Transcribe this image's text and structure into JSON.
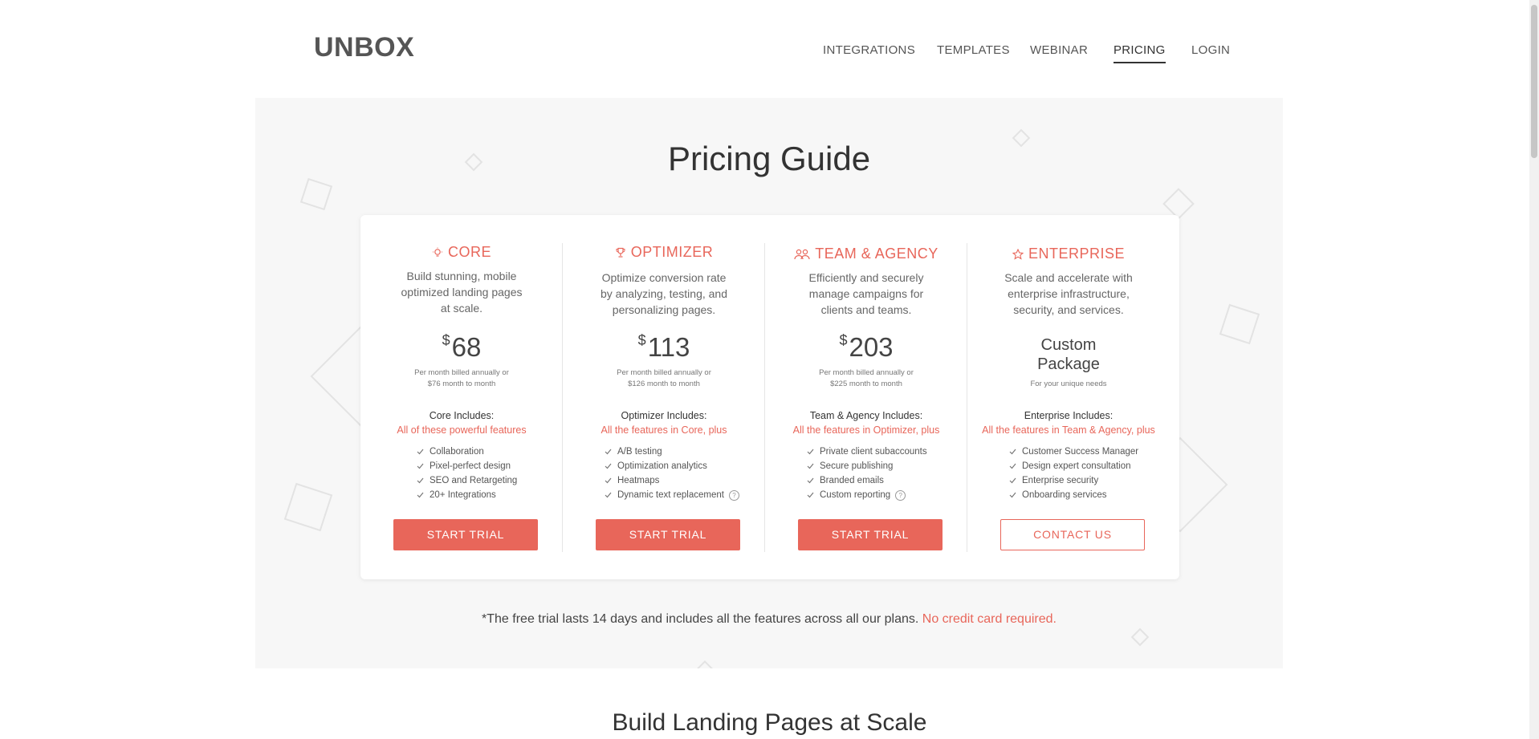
{
  "header": {
    "logo": "UNBOX",
    "nav": [
      "INTEGRATIONS",
      "TEMPLATES",
      "WEBINAR",
      "PRICING",
      "LOGIN"
    ],
    "active_nav": "PRICING"
  },
  "hero": {
    "title": "Pricing Guide",
    "trial_note": "*The free trial lasts 14 days and includes all the features across all our plans.",
    "trial_note_highlight": "No credit card required."
  },
  "plans": [
    {
      "icon": "lightbulb-icon",
      "name": "CORE",
      "desc_lines": [
        "Build stunning, mobile",
        "optimized landing pages",
        "at scale."
      ],
      "currency": "$",
      "price": "68",
      "note_lines": [
        "Per month billed annually or",
        "$76 month to month"
      ],
      "includes": "Core Includes:",
      "includes_sub": "All of these powerful features",
      "features": [
        "Collaboration",
        "Pixel-perfect design",
        "SEO and Retargeting",
        "20+ Integrations"
      ],
      "button": "START TRIAL"
    },
    {
      "icon": "trophy-icon",
      "name": "OPTIMIZER",
      "desc_lines": [
        "Optimize conversion rate",
        "by analyzing, testing, and",
        "personalizing pages."
      ],
      "currency": "$",
      "price": "113",
      "note_lines": [
        "Per month billed annually or",
        "$126 month to month"
      ],
      "includes": "Optimizer Includes:",
      "includes_sub": "All the features in Core, plus",
      "features": [
        "A/B testing",
        "Optimization analytics",
        "Heatmaps",
        "Dynamic text replacement"
      ],
      "button": "START TRIAL"
    },
    {
      "icon": "team-icon",
      "name": "TEAM & AGENCY",
      "desc_lines": [
        "Efficiently and securely",
        "manage campaigns for",
        "clients and teams."
      ],
      "currency": "$",
      "price": "203",
      "note_lines": [
        "Per month billed annually or",
        "$225 month to month"
      ],
      "includes": "Team & Agency Includes:",
      "includes_sub": "All the features in Optimizer, plus",
      "features": [
        "Private client subaccounts",
        "Secure publishing",
        "Branded emails",
        "Custom reporting"
      ],
      "button": "START TRIAL"
    },
    {
      "icon": "star-icon",
      "name": "ENTERPRISE",
      "desc_lines": [
        "Scale and accelerate with",
        "enterprise infrastructure,",
        "security, and services."
      ],
      "custom_lines": [
        "Custom",
        "Package"
      ],
      "custom_note": "For your unique needs",
      "includes": "Enterprise Includes:",
      "includes_sub": "All the features in Team & Agency, plus",
      "features": [
        "Customer Success Manager",
        "Design expert consultation",
        "Enterprise security",
        "Onboarding services"
      ],
      "button": "CONTACT US"
    }
  ],
  "help_glyph": "?",
  "section": {
    "title": "Build Landing Pages at Scale"
  },
  "colors": {
    "accent": "#e8665a",
    "hero_bg": "#f7f7f7"
  }
}
